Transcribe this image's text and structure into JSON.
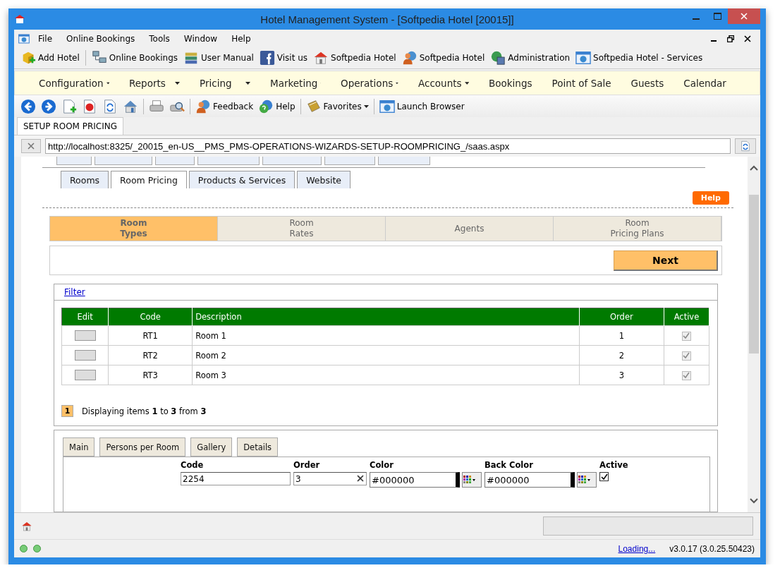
{
  "window": {
    "title": "Hotel Management System - [Softpedia Hotel [20015]]"
  },
  "menu": [
    "File",
    "Online Bookings",
    "Tools",
    "Window",
    "Help"
  ],
  "toolbar": [
    {
      "kind": "box",
      "label": "Add Hotel"
    },
    {
      "kind": "network",
      "label": "Online Bookings"
    },
    {
      "kind": "books",
      "label": "User Manual"
    },
    {
      "kind": "facebook",
      "label": "Visit us"
    },
    {
      "kind": "house",
      "label": "Softpedia Hotel"
    },
    {
      "kind": "person",
      "label": "Softpedia Hotel"
    },
    {
      "kind": "server",
      "label": "Administration"
    },
    {
      "kind": "browser",
      "label": "Softpedia Hotel - Services"
    }
  ],
  "nav": [
    {
      "label": "Configuration",
      "dropdown": true
    },
    {
      "label": "Reports",
      "dropdown": true
    },
    {
      "label": "Pricing",
      "dropdown": true
    },
    {
      "label": "Marketing",
      "dropdown": true
    },
    {
      "label": "Operations",
      "dropdown": true
    },
    {
      "label": "Accounts",
      "dropdown": true
    },
    {
      "label": "Bookings",
      "dropdown": false
    },
    {
      "label": "Point of Sale",
      "dropdown": false
    },
    {
      "label": "Guests",
      "dropdown": false
    },
    {
      "label": "Calendar",
      "dropdown": false
    }
  ],
  "toolbar2": [
    {
      "kind": "back"
    },
    {
      "kind": "forward"
    },
    {
      "kind": "new"
    },
    {
      "kind": "stop"
    },
    {
      "kind": "refresh"
    },
    {
      "kind": "home"
    },
    {
      "kind": "print"
    },
    {
      "kind": "preview"
    },
    {
      "kind": "person",
      "label": "Feedback",
      "dropdown": false
    },
    {
      "kind": "help",
      "label": "Help",
      "dropdown": false
    },
    {
      "kind": "book",
      "label": "Favorites",
      "dropdown": true
    },
    {
      "kind": "browser",
      "label": "Launch Browser",
      "dropdown": false
    }
  ],
  "doc_tab": "SETUP ROOM PRICING",
  "url": "http://localhost:8325/_20015_en-US__PMS_PMS-OPERATIONS-WIZARDS-SETUP-ROOMPRICING_/saas.aspx",
  "subtabs": [
    {
      "label": "Rooms",
      "selected": false
    },
    {
      "label": "Room Pricing",
      "selected": true
    },
    {
      "label": "Products & Services",
      "selected": false
    },
    {
      "label": "Website",
      "selected": false
    }
  ],
  "help_button": "Help",
  "steps": [
    {
      "lines": [
        "Room",
        "Types"
      ],
      "selected": true
    },
    {
      "lines": [
        "Room",
        "Rates"
      ],
      "selected": false
    },
    {
      "lines": [
        "Agents"
      ],
      "selected": false
    },
    {
      "lines": [
        "Room",
        "Pricing Plans"
      ],
      "selected": false
    }
  ],
  "next_button": "Next",
  "filter_link": "Filter",
  "table": {
    "columns": [
      "Edit",
      "Code",
      "Description",
      "Order",
      "Active"
    ],
    "rows": [
      {
        "code": "RT1",
        "description": "Room 1",
        "order": "1",
        "active": true
      },
      {
        "code": "RT2",
        "description": "Room 2",
        "order": "2",
        "active": true
      },
      {
        "code": "RT3",
        "description": "Room 3",
        "order": "3",
        "active": true
      }
    ]
  },
  "pager": {
    "page": "1",
    "text": "Displaying items **1** to **3** from **3**"
  },
  "form_tabs": [
    "Main",
    "Persons per Room",
    "Gallery",
    "Details"
  ],
  "form": {
    "code": {
      "label": "Code",
      "value": "2254"
    },
    "order": {
      "label": "Order",
      "value": "3"
    },
    "color": {
      "label": "Color",
      "value": "#000000"
    },
    "back_color": {
      "label": "Back Color",
      "value": "#000000"
    },
    "active": {
      "label": "Active",
      "checked": true
    }
  },
  "status": {
    "link": "Loading...",
    "version": "v3.0.17 (3.0.25.50423)"
  }
}
